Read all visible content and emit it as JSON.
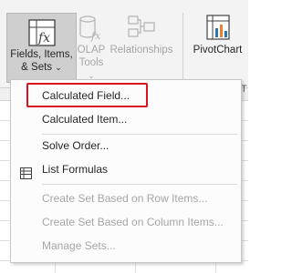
{
  "ribbon": {
    "fields_items_sets": {
      "line1": "Fields, Items,",
      "line2": "& Sets",
      "arrow": "⌄"
    },
    "olap_tools": {
      "line1": "OLAP",
      "line2": "Tools",
      "arrow": "⌄"
    },
    "relationships": {
      "label": "Relationships"
    },
    "pivotchart": {
      "label": "PivotChart"
    },
    "right_edge_text": "T"
  },
  "menu": {
    "items": [
      {
        "label": "Calculated Field...",
        "enabled": true
      },
      {
        "label": "Calculated Item...",
        "enabled": true
      },
      {
        "label": "Solve Order...",
        "enabled": true
      },
      {
        "label": "List Formulas",
        "enabled": true,
        "icon": "list-formulas-icon"
      },
      {
        "label": "Create Set Based on Row Items...",
        "enabled": false
      },
      {
        "label": "Create Set Based on Column Items...",
        "enabled": false
      },
      {
        "label": "Manage Sets...",
        "enabled": false
      }
    ]
  },
  "colors": {
    "highlight": "#d9141c",
    "ribbon_bg": "#f3f3f3",
    "disabled_text": "#a6a6a6"
  }
}
